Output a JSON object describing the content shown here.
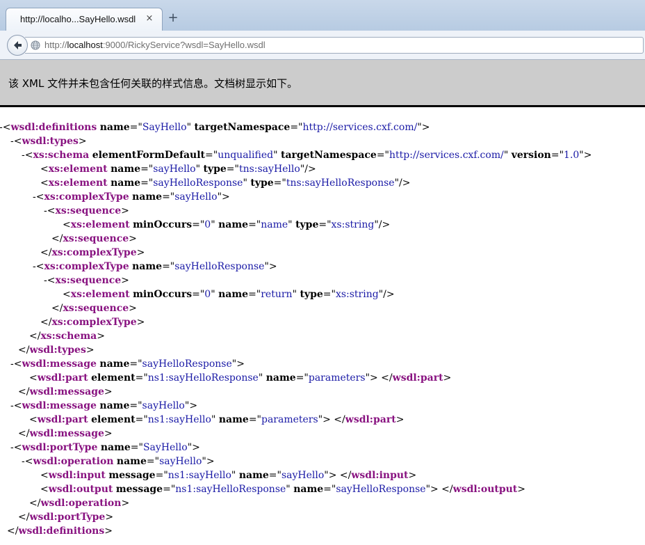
{
  "browser": {
    "tab_title": "http://localho...SayHello.wsdl",
    "tab_close": "×",
    "new_tab": "+",
    "url_scheme": "http://",
    "url_host": "localhost",
    "url_rest": ":9000/RickyService?wsdl=SayHello.wsdl"
  },
  "xml_viewer": {
    "info_text": "该 XML 文件并未包含任何关联的样式信息。文档树显示如下。",
    "lines": [
      {
        "indent": 0,
        "toggle": "-",
        "segs": [
          [
            "p",
            "<"
          ],
          [
            "t",
            "wsdl:definitions"
          ],
          [
            "p",
            " "
          ],
          [
            "a",
            "name"
          ],
          [
            "p",
            "=\""
          ],
          [
            "v",
            "SayHello"
          ],
          [
            "p",
            "\" "
          ],
          [
            "a",
            "targetNamespace"
          ],
          [
            "p",
            "=\""
          ],
          [
            "v",
            "http://services.cxf.com/"
          ],
          [
            "p",
            "\">"
          ]
        ]
      },
      {
        "indent": 1,
        "toggle": "-",
        "segs": [
          [
            "p",
            "<"
          ],
          [
            "t",
            "wsdl:types"
          ],
          [
            "p",
            ">"
          ]
        ]
      },
      {
        "indent": 2,
        "toggle": "-",
        "segs": [
          [
            "p",
            "<"
          ],
          [
            "t",
            "xs:schema"
          ],
          [
            "p",
            " "
          ],
          [
            "a",
            "elementFormDefault"
          ],
          [
            "p",
            "=\""
          ],
          [
            "v",
            "unqualified"
          ],
          [
            "p",
            "\" "
          ],
          [
            "a",
            "targetNamespace"
          ],
          [
            "p",
            "=\""
          ],
          [
            "v",
            "http://services.cxf.com/"
          ],
          [
            "p",
            "\" "
          ],
          [
            "a",
            "version"
          ],
          [
            "p",
            "=\""
          ],
          [
            "v",
            "1.0"
          ],
          [
            "p",
            "\">"
          ]
        ]
      },
      {
        "indent": 3,
        "toggle": "",
        "segs": [
          [
            "p",
            "<"
          ],
          [
            "t",
            "xs:element"
          ],
          [
            "p",
            " "
          ],
          [
            "a",
            "name"
          ],
          [
            "p",
            "=\""
          ],
          [
            "v",
            "sayHello"
          ],
          [
            "p",
            "\" "
          ],
          [
            "a",
            "type"
          ],
          [
            "p",
            "=\""
          ],
          [
            "v",
            "tns:sayHello"
          ],
          [
            "p",
            "\"/>"
          ]
        ]
      },
      {
        "indent": 3,
        "toggle": "",
        "segs": [
          [
            "p",
            "<"
          ],
          [
            "t",
            "xs:element"
          ],
          [
            "p",
            " "
          ],
          [
            "a",
            "name"
          ],
          [
            "p",
            "=\""
          ],
          [
            "v",
            "sayHelloResponse"
          ],
          [
            "p",
            "\" "
          ],
          [
            "a",
            "type"
          ],
          [
            "p",
            "=\""
          ],
          [
            "v",
            "tns:sayHelloResponse"
          ],
          [
            "p",
            "\"/>"
          ]
        ]
      },
      {
        "indent": 3,
        "toggle": "-",
        "segs": [
          [
            "p",
            "<"
          ],
          [
            "t",
            "xs:complexType"
          ],
          [
            "p",
            " "
          ],
          [
            "a",
            "name"
          ],
          [
            "p",
            "=\""
          ],
          [
            "v",
            "sayHello"
          ],
          [
            "p",
            "\">"
          ]
        ]
      },
      {
        "indent": 4,
        "toggle": "-",
        "segs": [
          [
            "p",
            "<"
          ],
          [
            "t",
            "xs:sequence"
          ],
          [
            "p",
            ">"
          ]
        ]
      },
      {
        "indent": 5,
        "toggle": "",
        "segs": [
          [
            "p",
            "<"
          ],
          [
            "t",
            "xs:element"
          ],
          [
            "p",
            " "
          ],
          [
            "a",
            "minOccurs"
          ],
          [
            "p",
            "=\""
          ],
          [
            "v",
            "0"
          ],
          [
            "p",
            "\" "
          ],
          [
            "a",
            "name"
          ],
          [
            "p",
            "=\""
          ],
          [
            "v",
            "name"
          ],
          [
            "p",
            "\" "
          ],
          [
            "a",
            "type"
          ],
          [
            "p",
            "=\""
          ],
          [
            "v",
            "xs:string"
          ],
          [
            "p",
            "\"/>"
          ]
        ]
      },
      {
        "indent": 4,
        "toggle": "",
        "segs": [
          [
            "p",
            "</"
          ],
          [
            "t",
            "xs:sequence"
          ],
          [
            "p",
            ">"
          ]
        ]
      },
      {
        "indent": 3,
        "toggle": "",
        "segs": [
          [
            "p",
            "</"
          ],
          [
            "t",
            "xs:complexType"
          ],
          [
            "p",
            ">"
          ]
        ]
      },
      {
        "indent": 3,
        "toggle": "-",
        "segs": [
          [
            "p",
            "<"
          ],
          [
            "t",
            "xs:complexType"
          ],
          [
            "p",
            " "
          ],
          [
            "a",
            "name"
          ],
          [
            "p",
            "=\""
          ],
          [
            "v",
            "sayHelloResponse"
          ],
          [
            "p",
            "\">"
          ]
        ]
      },
      {
        "indent": 4,
        "toggle": "-",
        "segs": [
          [
            "p",
            "<"
          ],
          [
            "t",
            "xs:sequence"
          ],
          [
            "p",
            ">"
          ]
        ]
      },
      {
        "indent": 5,
        "toggle": "",
        "segs": [
          [
            "p",
            "<"
          ],
          [
            "t",
            "xs:element"
          ],
          [
            "p",
            " "
          ],
          [
            "a",
            "minOccurs"
          ],
          [
            "p",
            "=\""
          ],
          [
            "v",
            "0"
          ],
          [
            "p",
            "\" "
          ],
          [
            "a",
            "name"
          ],
          [
            "p",
            "=\""
          ],
          [
            "v",
            "return"
          ],
          [
            "p",
            "\" "
          ],
          [
            "a",
            "type"
          ],
          [
            "p",
            "=\""
          ],
          [
            "v",
            "xs:string"
          ],
          [
            "p",
            "\"/>"
          ]
        ]
      },
      {
        "indent": 4,
        "toggle": "",
        "segs": [
          [
            "p",
            "</"
          ],
          [
            "t",
            "xs:sequence"
          ],
          [
            "p",
            ">"
          ]
        ]
      },
      {
        "indent": 3,
        "toggle": "",
        "segs": [
          [
            "p",
            "</"
          ],
          [
            "t",
            "xs:complexType"
          ],
          [
            "p",
            ">"
          ]
        ]
      },
      {
        "indent": 2,
        "toggle": "",
        "segs": [
          [
            "p",
            "</"
          ],
          [
            "t",
            "xs:schema"
          ],
          [
            "p",
            ">"
          ]
        ]
      },
      {
        "indent": 1,
        "toggle": "",
        "segs": [
          [
            "p",
            "</"
          ],
          [
            "t",
            "wsdl:types"
          ],
          [
            "p",
            ">"
          ]
        ]
      },
      {
        "indent": 1,
        "toggle": "-",
        "segs": [
          [
            "p",
            "<"
          ],
          [
            "t",
            "wsdl:message"
          ],
          [
            "p",
            " "
          ],
          [
            "a",
            "name"
          ],
          [
            "p",
            "=\""
          ],
          [
            "v",
            "sayHelloResponse"
          ],
          [
            "p",
            "\">"
          ]
        ]
      },
      {
        "indent": 2,
        "toggle": "",
        "segs": [
          [
            "p",
            "<"
          ],
          [
            "t",
            "wsdl:part"
          ],
          [
            "p",
            " "
          ],
          [
            "a",
            "element"
          ],
          [
            "p",
            "=\""
          ],
          [
            "v",
            "ns1:sayHelloResponse"
          ],
          [
            "p",
            "\" "
          ],
          [
            "a",
            "name"
          ],
          [
            "p",
            "=\""
          ],
          [
            "v",
            "parameters"
          ],
          [
            "p",
            "\"> </"
          ],
          [
            "t",
            "wsdl:part"
          ],
          [
            "p",
            ">"
          ]
        ]
      },
      {
        "indent": 1,
        "toggle": "",
        "segs": [
          [
            "p",
            "</"
          ],
          [
            "t",
            "wsdl:message"
          ],
          [
            "p",
            ">"
          ]
        ]
      },
      {
        "indent": 1,
        "toggle": "-",
        "segs": [
          [
            "p",
            "<"
          ],
          [
            "t",
            "wsdl:message"
          ],
          [
            "p",
            " "
          ],
          [
            "a",
            "name"
          ],
          [
            "p",
            "=\""
          ],
          [
            "v",
            "sayHello"
          ],
          [
            "p",
            "\">"
          ]
        ]
      },
      {
        "indent": 2,
        "toggle": "",
        "segs": [
          [
            "p",
            "<"
          ],
          [
            "t",
            "wsdl:part"
          ],
          [
            "p",
            " "
          ],
          [
            "a",
            "element"
          ],
          [
            "p",
            "=\""
          ],
          [
            "v",
            "ns1:sayHello"
          ],
          [
            "p",
            "\" "
          ],
          [
            "a",
            "name"
          ],
          [
            "p",
            "=\""
          ],
          [
            "v",
            "parameters"
          ],
          [
            "p",
            "\"> </"
          ],
          [
            "t",
            "wsdl:part"
          ],
          [
            "p",
            ">"
          ]
        ]
      },
      {
        "indent": 1,
        "toggle": "",
        "segs": [
          [
            "p",
            "</"
          ],
          [
            "t",
            "wsdl:message"
          ],
          [
            "p",
            ">"
          ]
        ]
      },
      {
        "indent": 1,
        "toggle": "-",
        "segs": [
          [
            "p",
            "<"
          ],
          [
            "t",
            "wsdl:portType"
          ],
          [
            "p",
            " "
          ],
          [
            "a",
            "name"
          ],
          [
            "p",
            "=\""
          ],
          [
            "v",
            "SayHello"
          ],
          [
            "p",
            "\">"
          ]
        ]
      },
      {
        "indent": 2,
        "toggle": "-",
        "segs": [
          [
            "p",
            "<"
          ],
          [
            "t",
            "wsdl:operation"
          ],
          [
            "p",
            " "
          ],
          [
            "a",
            "name"
          ],
          [
            "p",
            "=\""
          ],
          [
            "v",
            "sayHello"
          ],
          [
            "p",
            "\">"
          ]
        ]
      },
      {
        "indent": 3,
        "toggle": "",
        "segs": [
          [
            "p",
            "<"
          ],
          [
            "t",
            "wsdl:input"
          ],
          [
            "p",
            " "
          ],
          [
            "a",
            "message"
          ],
          [
            "p",
            "=\""
          ],
          [
            "v",
            "ns1:sayHello"
          ],
          [
            "p",
            "\" "
          ],
          [
            "a",
            "name"
          ],
          [
            "p",
            "=\""
          ],
          [
            "v",
            "sayHello"
          ],
          [
            "p",
            "\"> </"
          ],
          [
            "t",
            "wsdl:input"
          ],
          [
            "p",
            ">"
          ]
        ]
      },
      {
        "indent": 3,
        "toggle": "",
        "segs": [
          [
            "p",
            "<"
          ],
          [
            "t",
            "wsdl:output"
          ],
          [
            "p",
            " "
          ],
          [
            "a",
            "message"
          ],
          [
            "p",
            "=\""
          ],
          [
            "v",
            "ns1:sayHelloResponse"
          ],
          [
            "p",
            "\" "
          ],
          [
            "a",
            "name"
          ],
          [
            "p",
            "=\""
          ],
          [
            "v",
            "sayHelloResponse"
          ],
          [
            "p",
            "\"> </"
          ],
          [
            "t",
            "wsdl:output"
          ],
          [
            "p",
            ">"
          ]
        ]
      },
      {
        "indent": 2,
        "toggle": "",
        "segs": [
          [
            "p",
            "</"
          ],
          [
            "t",
            "wsdl:operation"
          ],
          [
            "p",
            ">"
          ]
        ]
      },
      {
        "indent": 1,
        "toggle": "",
        "segs": [
          [
            "p",
            "</"
          ],
          [
            "t",
            "wsdl:portType"
          ],
          [
            "p",
            ">"
          ]
        ]
      },
      {
        "indent": 0,
        "toggle": "",
        "segs": [
          [
            "p",
            "</"
          ],
          [
            "t",
            "wsdl:definitions"
          ],
          [
            "p",
            ">"
          ]
        ]
      }
    ]
  }
}
